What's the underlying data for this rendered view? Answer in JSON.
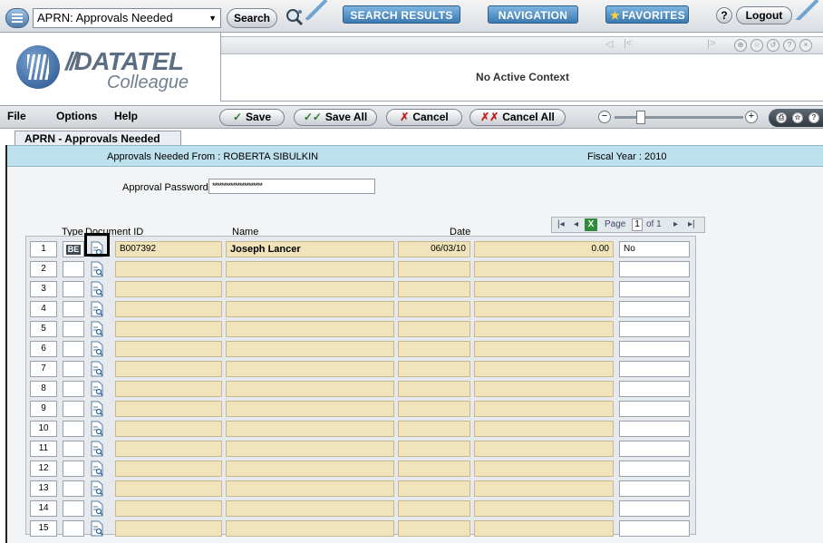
{
  "topbar": {
    "form_selector": "APRN: Approvals Needed",
    "search_label": "Search",
    "nav_tabs": [
      "SEARCH RESULTS",
      "NAVIGATION",
      "FAVORITES"
    ],
    "help_label": "?",
    "logout_label": "Logout"
  },
  "header": {
    "logo_brand": "DATATEL",
    "logo_sub": "Colleague",
    "context_message": "No Active Context"
  },
  "menubar": {
    "menus": [
      "File",
      "Options",
      "Help"
    ],
    "buttons": {
      "save": "Save",
      "save_all": "Save All",
      "cancel": "Cancel",
      "cancel_all": "Cancel All"
    }
  },
  "form": {
    "tab_title": "APRN - Approvals Needed",
    "approvals_from": "Approvals Needed From :  ROBERTA SIBULKIN",
    "fiscal_year": "Fiscal Year :  2010",
    "password_label": "Approval Password",
    "password_value": "**********************",
    "columns": {
      "type": "Type",
      "document_id": "Document ID",
      "name": "Name",
      "date": "Date"
    },
    "pager": {
      "page_label": "Page",
      "page_current": "1",
      "page_of": "of 1"
    },
    "rows": [
      {
        "num": "1",
        "type": "BE",
        "doc_id": "B007392",
        "name": "Joseph Lancer",
        "date": "06/03/10",
        "amount": "0.00",
        "flag": "No"
      },
      {
        "num": "2",
        "type": "",
        "doc_id": "",
        "name": "",
        "date": "",
        "amount": "",
        "flag": ""
      },
      {
        "num": "3",
        "type": "",
        "doc_id": "",
        "name": "",
        "date": "",
        "amount": "",
        "flag": ""
      },
      {
        "num": "4",
        "type": "",
        "doc_id": "",
        "name": "",
        "date": "",
        "amount": "",
        "flag": ""
      },
      {
        "num": "5",
        "type": "",
        "doc_id": "",
        "name": "",
        "date": "",
        "amount": "",
        "flag": ""
      },
      {
        "num": "6",
        "type": "",
        "doc_id": "",
        "name": "",
        "date": "",
        "amount": "",
        "flag": ""
      },
      {
        "num": "7",
        "type": "",
        "doc_id": "",
        "name": "",
        "date": "",
        "amount": "",
        "flag": ""
      },
      {
        "num": "8",
        "type": "",
        "doc_id": "",
        "name": "",
        "date": "",
        "amount": "",
        "flag": ""
      },
      {
        "num": "9",
        "type": "",
        "doc_id": "",
        "name": "",
        "date": "",
        "amount": "",
        "flag": ""
      },
      {
        "num": "10",
        "type": "",
        "doc_id": "",
        "name": "",
        "date": "",
        "amount": "",
        "flag": ""
      },
      {
        "num": "11",
        "type": "",
        "doc_id": "",
        "name": "",
        "date": "",
        "amount": "",
        "flag": ""
      },
      {
        "num": "12",
        "type": "",
        "doc_id": "",
        "name": "",
        "date": "",
        "amount": "",
        "flag": ""
      },
      {
        "num": "13",
        "type": "",
        "doc_id": "",
        "name": "",
        "date": "",
        "amount": "",
        "flag": ""
      },
      {
        "num": "14",
        "type": "",
        "doc_id": "",
        "name": "",
        "date": "",
        "amount": "",
        "flag": ""
      },
      {
        "num": "15",
        "type": "",
        "doc_id": "",
        "name": "",
        "date": "",
        "amount": "",
        "flag": ""
      }
    ]
  },
  "colors": {
    "banner": "#bfe0ed",
    "field_fill": "#f1e3ba",
    "nav_tab": "#3d79b0"
  }
}
